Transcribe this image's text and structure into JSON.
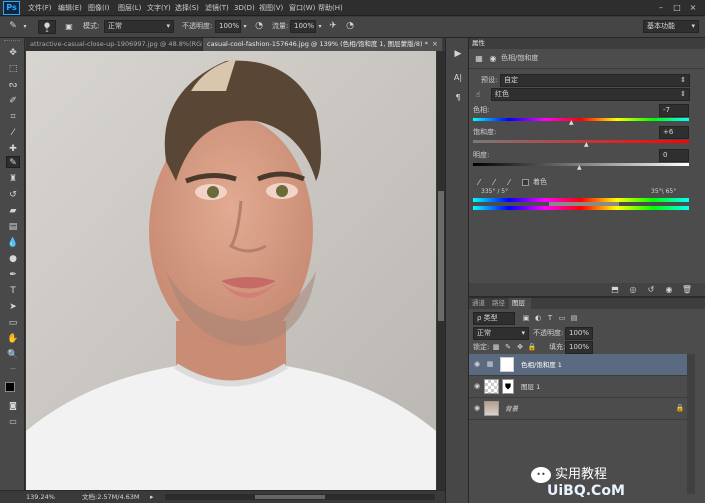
{
  "app": {
    "logo": "Ps"
  },
  "menu": [
    "文件(F)",
    "编辑(E)",
    "图像(I)",
    "图层(L)",
    "文字(Y)",
    "选择(S)",
    "滤镜(T)",
    "3D(D)",
    "视图(V)",
    "窗口(W)",
    "帮助(H)"
  ],
  "window_controls": [
    "–",
    "□",
    "×"
  ],
  "options": {
    "brush_size": "1",
    "mode_label": "模式:",
    "mode_value": "正常",
    "opacity_label": "不透明度:",
    "opacity_value": "100%",
    "flow_label": "流量:",
    "flow_value": "100%",
    "workspace": "基本功能"
  },
  "tabs": [
    {
      "label": "attractive-casual-close-up-1906997.jpg @ 48.8%(RGB...",
      "close": "×"
    },
    {
      "label": "casual-cool-fashion-157646.jpg @ 139% (色相/饱和度 1, 图层蒙版/8) *",
      "close": "×"
    }
  ],
  "status": {
    "zoom": "139.24%",
    "doc": "文档:2.57M/4.63M"
  },
  "properties": {
    "tab_label": "属性",
    "title": "色相/饱和度",
    "preset_label": "预设:",
    "preset_value": "自定",
    "channel": "红色",
    "hue_label": "色相:",
    "hue_value": "-7",
    "sat_label": "饱和度:",
    "sat_value": "+6",
    "light_label": "明度:",
    "light_value": "0",
    "colorize_label": "着色",
    "range_left": "335° / 5°",
    "range_right": "35°\\ 65°"
  },
  "layers": {
    "tabs": [
      "通道",
      "路径",
      "图层"
    ],
    "filter_label": "ρ 类型",
    "blend_mode": "正常",
    "opacity_label": "不透明度:",
    "opacity_value": "100%",
    "lock_label": "锁定:",
    "fill_label": "填充:",
    "fill_value": "100%",
    "items": [
      {
        "name": "色相/饱和度 1"
      },
      {
        "name": "图层 1"
      },
      {
        "name": "背景"
      }
    ]
  },
  "watermark": {
    "text": "实用教程",
    "site": "UiBQ.CoM"
  },
  "colors": {
    "accent": "#31a8ff",
    "panel": "#4c4c4c",
    "selected_row": "#5a6a80"
  }
}
